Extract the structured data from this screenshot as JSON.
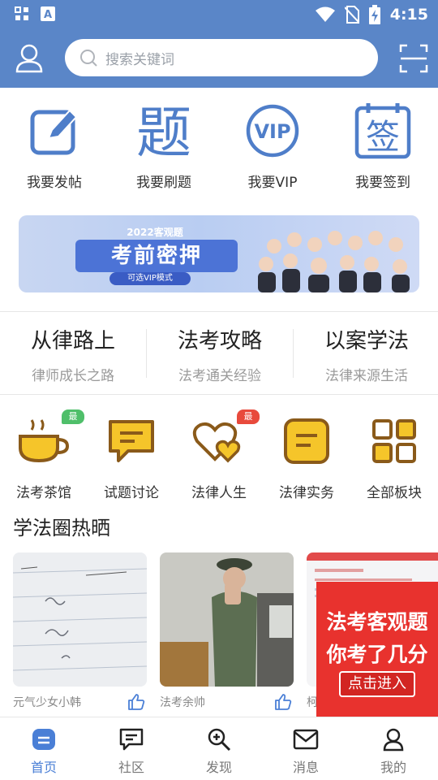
{
  "status_bar": {
    "time": "4:15"
  },
  "search": {
    "placeholder": "搜索关键词"
  },
  "quick_actions": [
    {
      "label": "我要发帖",
      "icon": "edit-icon"
    },
    {
      "label": "我要刷题",
      "icon": "question-icon",
      "glyph": "题"
    },
    {
      "label": "我要VIP",
      "icon": "vip-icon",
      "glyph": "VIP"
    },
    {
      "label": "我要签到",
      "icon": "checkin-icon",
      "glyph": "签"
    }
  ],
  "banner": {
    "year_tag": "2022客观题",
    "title": "考前密押",
    "subtitle": "可选VIP模式"
  },
  "channels": [
    {
      "title": "从律路上",
      "subtitle": "律师成长之路"
    },
    {
      "title": "法考攻略",
      "subtitle": "法考通关经验"
    },
    {
      "title": "以案学法",
      "subtitle": "法律来源生活"
    }
  ],
  "boards": [
    {
      "label": "法考茶馆",
      "icon": "teacup-icon",
      "badge": "最新",
      "badge_color": "#4fbf6a"
    },
    {
      "label": "试题讨论",
      "icon": "chat-icon"
    },
    {
      "label": "法律人生",
      "icon": "hearts-icon",
      "badge": "最热",
      "badge_color": "#e84a3c"
    },
    {
      "label": "法律实务",
      "icon": "note-icon"
    },
    {
      "label": "全部板块",
      "icon": "grid-icon"
    }
  ],
  "section": {
    "title": "学法圈热晒"
  },
  "posts": [
    {
      "author": "元气少女小韩"
    },
    {
      "author": "法考余帅"
    },
    {
      "author": "柯"
    }
  ],
  "float_ad": {
    "line1": "法考客观题",
    "line2": "你考了几分",
    "button": "点击进入"
  },
  "bottom_nav": [
    {
      "label": "首页",
      "icon": "home-icon",
      "active": true
    },
    {
      "label": "社区",
      "icon": "community-icon"
    },
    {
      "label": "发现",
      "icon": "discover-icon"
    },
    {
      "label": "消息",
      "icon": "message-icon"
    },
    {
      "label": "我的",
      "icon": "profile-icon"
    }
  ],
  "colors": {
    "brand": "#5a86c8",
    "accent_blue": "#4a7fd6",
    "board_yellow": "#f5c52a",
    "board_brown": "#8a5a1a",
    "ad_red": "#e8322e"
  }
}
